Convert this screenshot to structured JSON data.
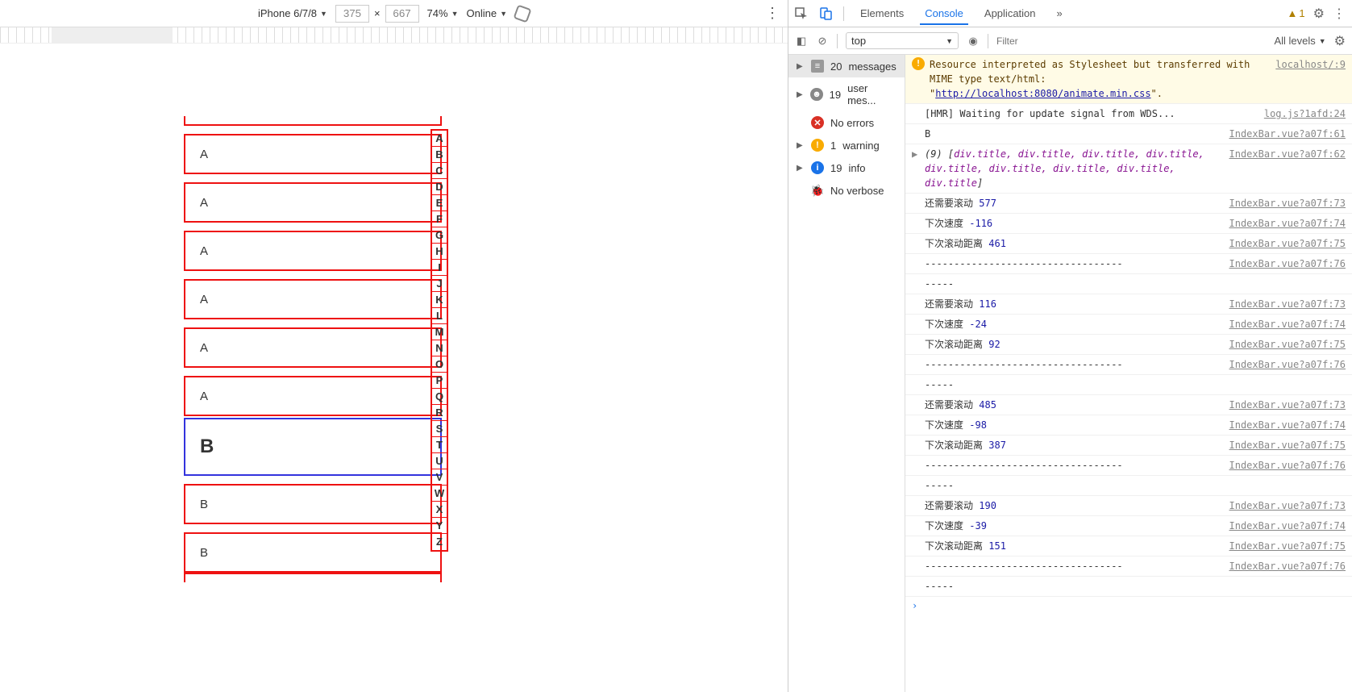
{
  "device_toolbar": {
    "device": "iPhone 6/7/8",
    "width": "375",
    "height": "667",
    "times": "×",
    "zoom": "74%",
    "online": "Online"
  },
  "phone_list": {
    "items_a": [
      "A",
      "A",
      "A",
      "A",
      "A",
      "A"
    ],
    "title_b": "B",
    "items_b": [
      "B",
      "B"
    ],
    "index_letters": [
      "A",
      "B",
      "C",
      "D",
      "E",
      "F",
      "G",
      "H",
      "I",
      "J",
      "K",
      "L",
      "M",
      "N",
      "O",
      "P",
      "Q",
      "R",
      "S",
      "T",
      "U",
      "V",
      "W",
      "X",
      "Y",
      "Z"
    ]
  },
  "devtools": {
    "tabs": {
      "elements": "Elements",
      "console": "Console",
      "application": "Application"
    },
    "more": "»",
    "warn_count": "1"
  },
  "console_toolbar": {
    "context": "top",
    "filter_placeholder": "Filter",
    "levels": "All levels"
  },
  "sidebar": {
    "messages": {
      "count": "20",
      "label": "messages"
    },
    "user": {
      "count": "19",
      "label": "user mes..."
    },
    "errors": {
      "label": "No errors"
    },
    "warnings": {
      "count": "1",
      "label": "warning"
    },
    "info": {
      "count": "19",
      "label": "info"
    },
    "verbose": {
      "label": "No verbose"
    }
  },
  "log": {
    "r1": {
      "text1": "Resource interpreted as Stylesheet but transferred with MIME type text/html: \"",
      "link_a": "localhost/:9",
      "link_b": "http://localhost:8080/animate.min.css",
      "text2": "\"."
    },
    "r2": {
      "text": "[HMR] Waiting for update signal from WDS...",
      "src": "log.js?1afd:24"
    },
    "r3": {
      "text": "B",
      "src": "IndexBar.vue?a07f:61"
    },
    "r4": {
      "src": "IndexBar.vue?a07f:62",
      "pre": "(9) [",
      "items": "div.title, div.title, div.title, div.title, div.title, div.title, div.title, div.title, div.title",
      "post": "]"
    },
    "scroll_label": "还需要滚动",
    "speed_label": "下次速度",
    "dist_label": "下次滚动距离",
    "dashes": "----------------------------------",
    "dashes2": "-----",
    "src73": "IndexBar.vue?a07f:73",
    "src74": "IndexBar.vue?a07f:74",
    "src75": "IndexBar.vue?a07f:75",
    "src76": "IndexBar.vue?a07f:76",
    "g1": {
      "scroll": "577",
      "speed": "-116",
      "dist": "461"
    },
    "g2": {
      "scroll": "116",
      "speed": "-24",
      "dist": "92"
    },
    "g3": {
      "scroll": "485",
      "speed": "-98",
      "dist": "387"
    },
    "g4": {
      "scroll": "190",
      "speed": "-39",
      "dist": "151"
    }
  }
}
